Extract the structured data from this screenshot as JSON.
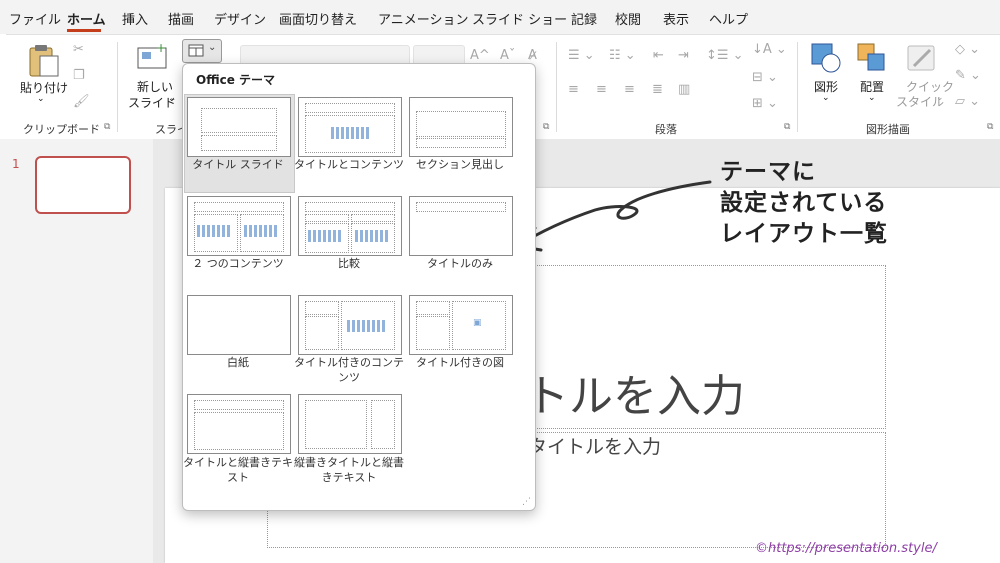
{
  "menu": {
    "items": [
      "ファイル",
      "ホーム",
      "挿入",
      "描画",
      "デザイン",
      "画面切り替え",
      "アニメーション",
      "スライド ショー",
      "記録",
      "校閲",
      "表示",
      "ヘルプ"
    ],
    "active": "ホーム"
  },
  "ribbon": {
    "paste_label": "貼り付け",
    "new_slide_label": "新しい",
    "new_slide_label2": "スライド",
    "clipboard_group": "クリップボード",
    "slides_group": "スライ",
    "paragraph_group": "段落",
    "drawing_group": "図形描画",
    "shapes_label": "図形",
    "arrange_label": "配置",
    "quickstyle_label1": "クイック",
    "quickstyle_label2": "スタイル"
  },
  "left_pane": {
    "slide_number": "1"
  },
  "slide": {
    "title_placeholder": "トルを入力",
    "subtitle_placeholder": "タイトルを入力"
  },
  "dropdown": {
    "title": "Office テーマ",
    "layouts": [
      "タイトル スライド",
      "タイトルとコンテンツ",
      "セクション見出し",
      "２ つのコンテンツ",
      "比較",
      "タイトルのみ",
      "白紙",
      "タイトル付きのコンテンツ",
      "タイトル付きの図",
      "タイトルと縦書きテキスト",
      "縦書きタイトルと縦書きテキスト"
    ],
    "selected": "タイトル スライド"
  },
  "annotation": {
    "text": "テーマに\n設定されている\nレイアウト一覧"
  },
  "copyright": "©https://presentation.style/",
  "colors": {
    "accent": "#c43e1c",
    "thumb_border": "#c0504d",
    "watermark": "#8e3fa6"
  }
}
